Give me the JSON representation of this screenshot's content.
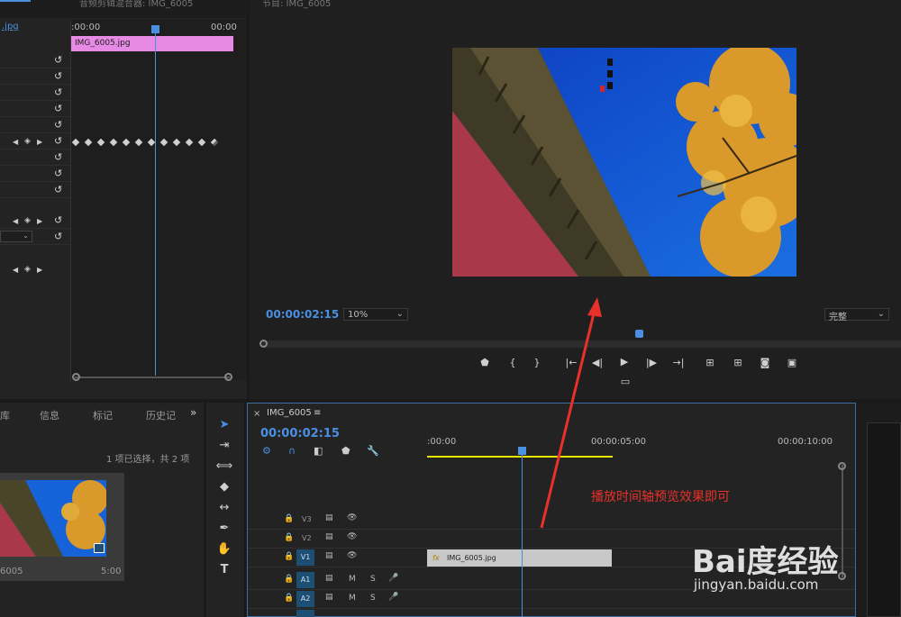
{
  "effect_controls": {
    "tab_file": ".jpg",
    "tab_source": "音频剪辑混合器: IMG_6005",
    "ruler_start": ":00:00",
    "ruler_end": "00:00",
    "clip_label": "IMG_6005.jpg"
  },
  "monitor": {
    "tab_title": "节目: IMG_6005",
    "timecode": "00:00:02:15",
    "zoom": "10%",
    "quality": "完整"
  },
  "project": {
    "tabs": [
      "库",
      "信息",
      "标记",
      "历史记"
    ],
    "selection": "1 项已选择，共 2 项",
    "thumb_name": "6005",
    "thumb_duration": "5:00"
  },
  "timeline": {
    "sequence_name": "IMG_6005",
    "timecode": "00:00:02:15",
    "ruler_labels": [
      ":00:00",
      "00:00:05:00",
      "00:00:10:00"
    ],
    "tracks": [
      {
        "name": "V3"
      },
      {
        "name": "V2"
      },
      {
        "name": "V1",
        "clip": "IMG_6005.jpg"
      },
      {
        "name": "A1"
      },
      {
        "name": "A2"
      }
    ],
    "mute_label": "M",
    "solo_label": "S"
  },
  "annotation": {
    "text": "播放时间轴预览效果即可"
  },
  "watermark": {
    "brand": "Bai度经验",
    "url": "jingyan.baidu.com"
  },
  "colors": {
    "accent_blue": "#4a90e2",
    "clip_pink": "#e68ae6",
    "clip_gray": "#c8c8c8",
    "arrow_red": "#e8312a",
    "work_area_yellow": "#e6e600"
  }
}
